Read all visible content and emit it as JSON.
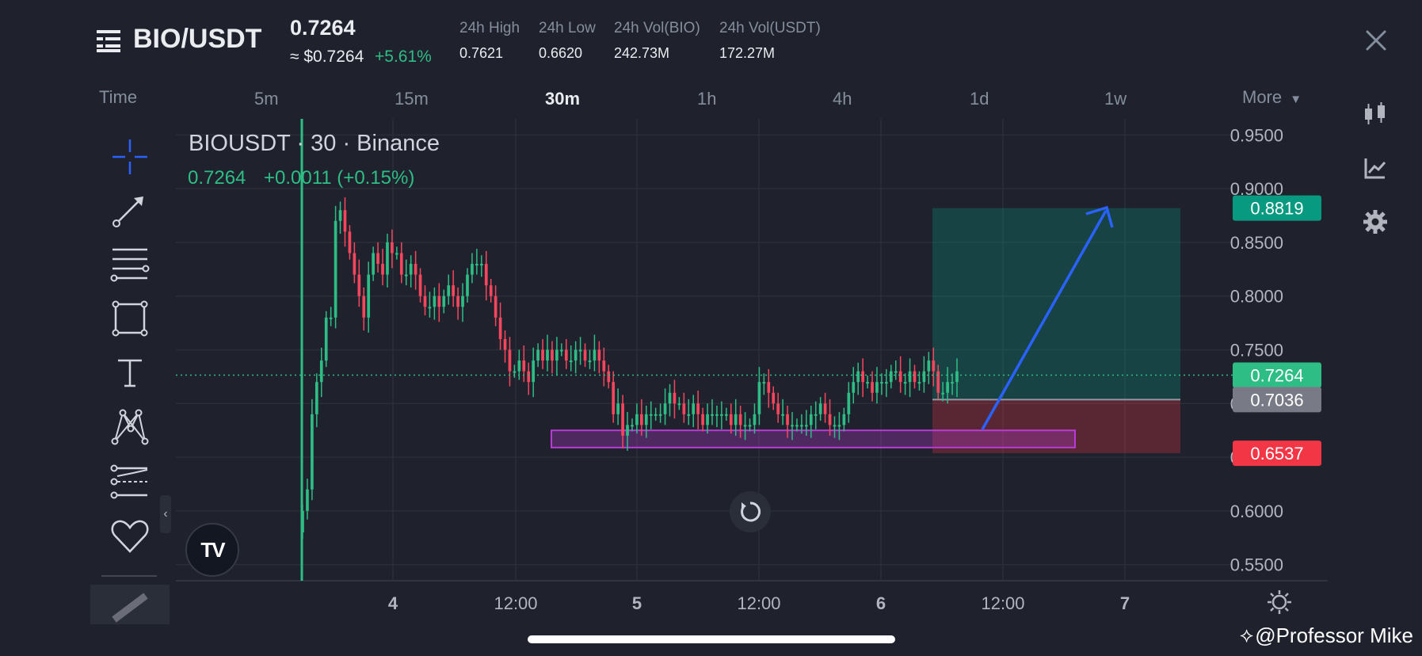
{
  "header": {
    "pair": "BIO/USDT",
    "price": "0.7264",
    "usd_price": "≈ $0.7264",
    "change_pct": "+5.61%",
    "stats": [
      {
        "label": "24h High",
        "value": "0.7621"
      },
      {
        "label": "24h Low",
        "value": "0.6620"
      },
      {
        "label": "24h Vol(BIO)",
        "value": "242.73M"
      },
      {
        "label": "24h Vol(USDT)",
        "value": "172.27M"
      }
    ]
  },
  "timeframes": {
    "time_label": "Time",
    "items": [
      "5m",
      "15m",
      "30m",
      "1h",
      "4h",
      "1d",
      "1w"
    ],
    "active": "30m",
    "more_label": "More"
  },
  "chart": {
    "title": "BIOUSDT · 30 · Binance",
    "last_value": "0.7264",
    "change": "+0.0011 (+0.15%)",
    "watermark": "@Professor Mike",
    "logo_text": "TV"
  },
  "chart_data": {
    "type": "candlestick",
    "symbol": "BIOUSDT",
    "interval": "30",
    "exchange": "Binance",
    "y_ticks": [
      "0.9500",
      "0.9000",
      "0.8500",
      "0.8000",
      "0.7500",
      "0.7000",
      "0.6500",
      "0.6000",
      "0.5500"
    ],
    "x_ticks": [
      "4",
      "12:00",
      "5",
      "12:00",
      "6",
      "12:00",
      "7"
    ],
    "ylim": [
      0.535,
      0.965
    ],
    "price_tags": [
      {
        "label": "0.8819",
        "value": 0.8819,
        "color": "#089981"
      },
      {
        "label": "0.7264",
        "value": 0.7264,
        "color": "#2ebd85"
      },
      {
        "label": "0.7036",
        "value": 0.7036,
        "color": "#787b86"
      },
      {
        "label": "0.6537",
        "value": 0.6537,
        "color": "#f23645"
      }
    ],
    "position": {
      "entry": 0.7036,
      "target": 0.8819,
      "stop": 0.6537
    },
    "support_zone": [
      0.659,
      0.675
    ],
    "current_price": 0.7264,
    "colors": {
      "up": "#2ebd85",
      "down": "#f6465d",
      "zone": "#b83bd6",
      "arrow": "#2962ff"
    }
  },
  "icons": {
    "menu": "menu-icon",
    "close": "close-icon",
    "reset": "reset-icon",
    "settings": "settings-icon"
  }
}
